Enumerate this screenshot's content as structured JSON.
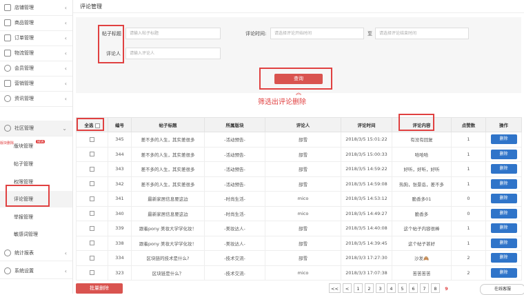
{
  "sidebar": {
    "items": [
      {
        "label": "店铺管理",
        "chev": "‹"
      },
      {
        "label": "商品管理",
        "chev": "‹"
      },
      {
        "label": "订单管理",
        "chev": "‹"
      },
      {
        "label": "物流管理",
        "chev": "‹"
      },
      {
        "label": "会员管理",
        "chev": "‹"
      },
      {
        "label": "营销管理",
        "chev": "‹"
      },
      {
        "label": "资讯管理",
        "chev": "‹"
      },
      {
        "label": "社区管理",
        "chev": "⌄"
      }
    ],
    "sub_items": [
      "版块管理",
      "帖子管理",
      "权限管理",
      "评论管理",
      "举报管理",
      "敏感词管理"
    ],
    "new_badge": "NEW",
    "side_note": "版块删除",
    "bottom_items": [
      {
        "label": "统计报表",
        "chev": "‹"
      },
      {
        "label": "系统设置",
        "chev": "‹"
      }
    ]
  },
  "header": {
    "title": "评论管理"
  },
  "filter": {
    "post_title_label": "帖子标题",
    "post_title_placeholder": "请输入帖子标题",
    "comment_time_label": "评论时间:",
    "start_placeholder": "请选择评论开始时间",
    "to_label": "至",
    "end_placeholder": "请选择评论结束时间",
    "commenter_label": "评论人",
    "commenter_placeholder": "请输入评论人",
    "query_label": "查询"
  },
  "annotation": "筛选出评论删除",
  "annotation_arrow": "︽",
  "table": {
    "headers": [
      "全选",
      "编号",
      "帖子标题",
      "所属版块",
      "评论人",
      "评论时间",
      "评论内容",
      "点赞数",
      "操作"
    ],
    "rows": [
      {
        "id": "345",
        "title": "差不多的人生，其实差很多",
        "board": "-活动预告-",
        "user": "部雪",
        "time": "2018/3/5 15:01:22",
        "content": "有没有回复",
        "likes": "1"
      },
      {
        "id": "344",
        "title": "差不多的人生，其实差很多",
        "board": "-活动预告-",
        "user": "部雪",
        "time": "2018/3/5 15:00:33",
        "content": "哈哈哈",
        "likes": "1"
      },
      {
        "id": "343",
        "title": "差不多的人生，其实差很多",
        "board": "-活动预告-",
        "user": "部雪",
        "time": "2018/3/5 14:59:22",
        "content": "好听，好听，好听",
        "likes": "1"
      },
      {
        "id": "342",
        "title": "差不多的人生，其实差很多",
        "board": "-活动预告-",
        "user": "部雪",
        "time": "2018/3/5 14:59:08",
        "content": "热狗，张景岳，差不多",
        "likes": "1"
      },
      {
        "id": "341",
        "title": "最新家居信息要这边",
        "board": "-时尚生活-",
        "user": "mico",
        "time": "2018/3/5 14:53:12",
        "content": "脆香多01",
        "likes": "0"
      },
      {
        "id": "340",
        "title": "最新家居信息要这边",
        "board": "-时尚生活-",
        "user": "mico",
        "time": "2018/3/5 14:49:27",
        "content": "脆香多",
        "likes": "0"
      },
      {
        "id": "339",
        "title": "跟着pony 美妆大学学化妆！",
        "board": "-美妆达人-",
        "user": "部雪",
        "time": "2018/3/5 14:40:08",
        "content": "这个帖子内容很棒",
        "likes": "1"
      },
      {
        "id": "338",
        "title": "跟着pony 美妆大学学化妆！",
        "board": "-美妆达人-",
        "user": "部雪",
        "time": "2018/3/5 14:39:45",
        "content": "这个帖子甚好",
        "likes": "1"
      },
      {
        "id": "334",
        "title": "区块链的技术是什么?",
        "board": "-技术交流-",
        "user": "部雪",
        "time": "2018/3/3 17:27:30",
        "content": "沙发🙈",
        "likes": "2"
      },
      {
        "id": "323",
        "title": "区块链是什么？",
        "board": "-技术交流-",
        "user": "mico",
        "time": "2018/3/3 17:07:38",
        "content": "苦苦苦苦",
        "likes": "2"
      }
    ],
    "delete_label": "删除"
  },
  "batch_delete_label": "批量删除",
  "pager": [
    "<<",
    "<",
    "1",
    "2",
    "3",
    "4",
    "5",
    "6",
    "7",
    "8",
    "9"
  ],
  "pager_active": "9",
  "online_service_label": "在线客服"
}
